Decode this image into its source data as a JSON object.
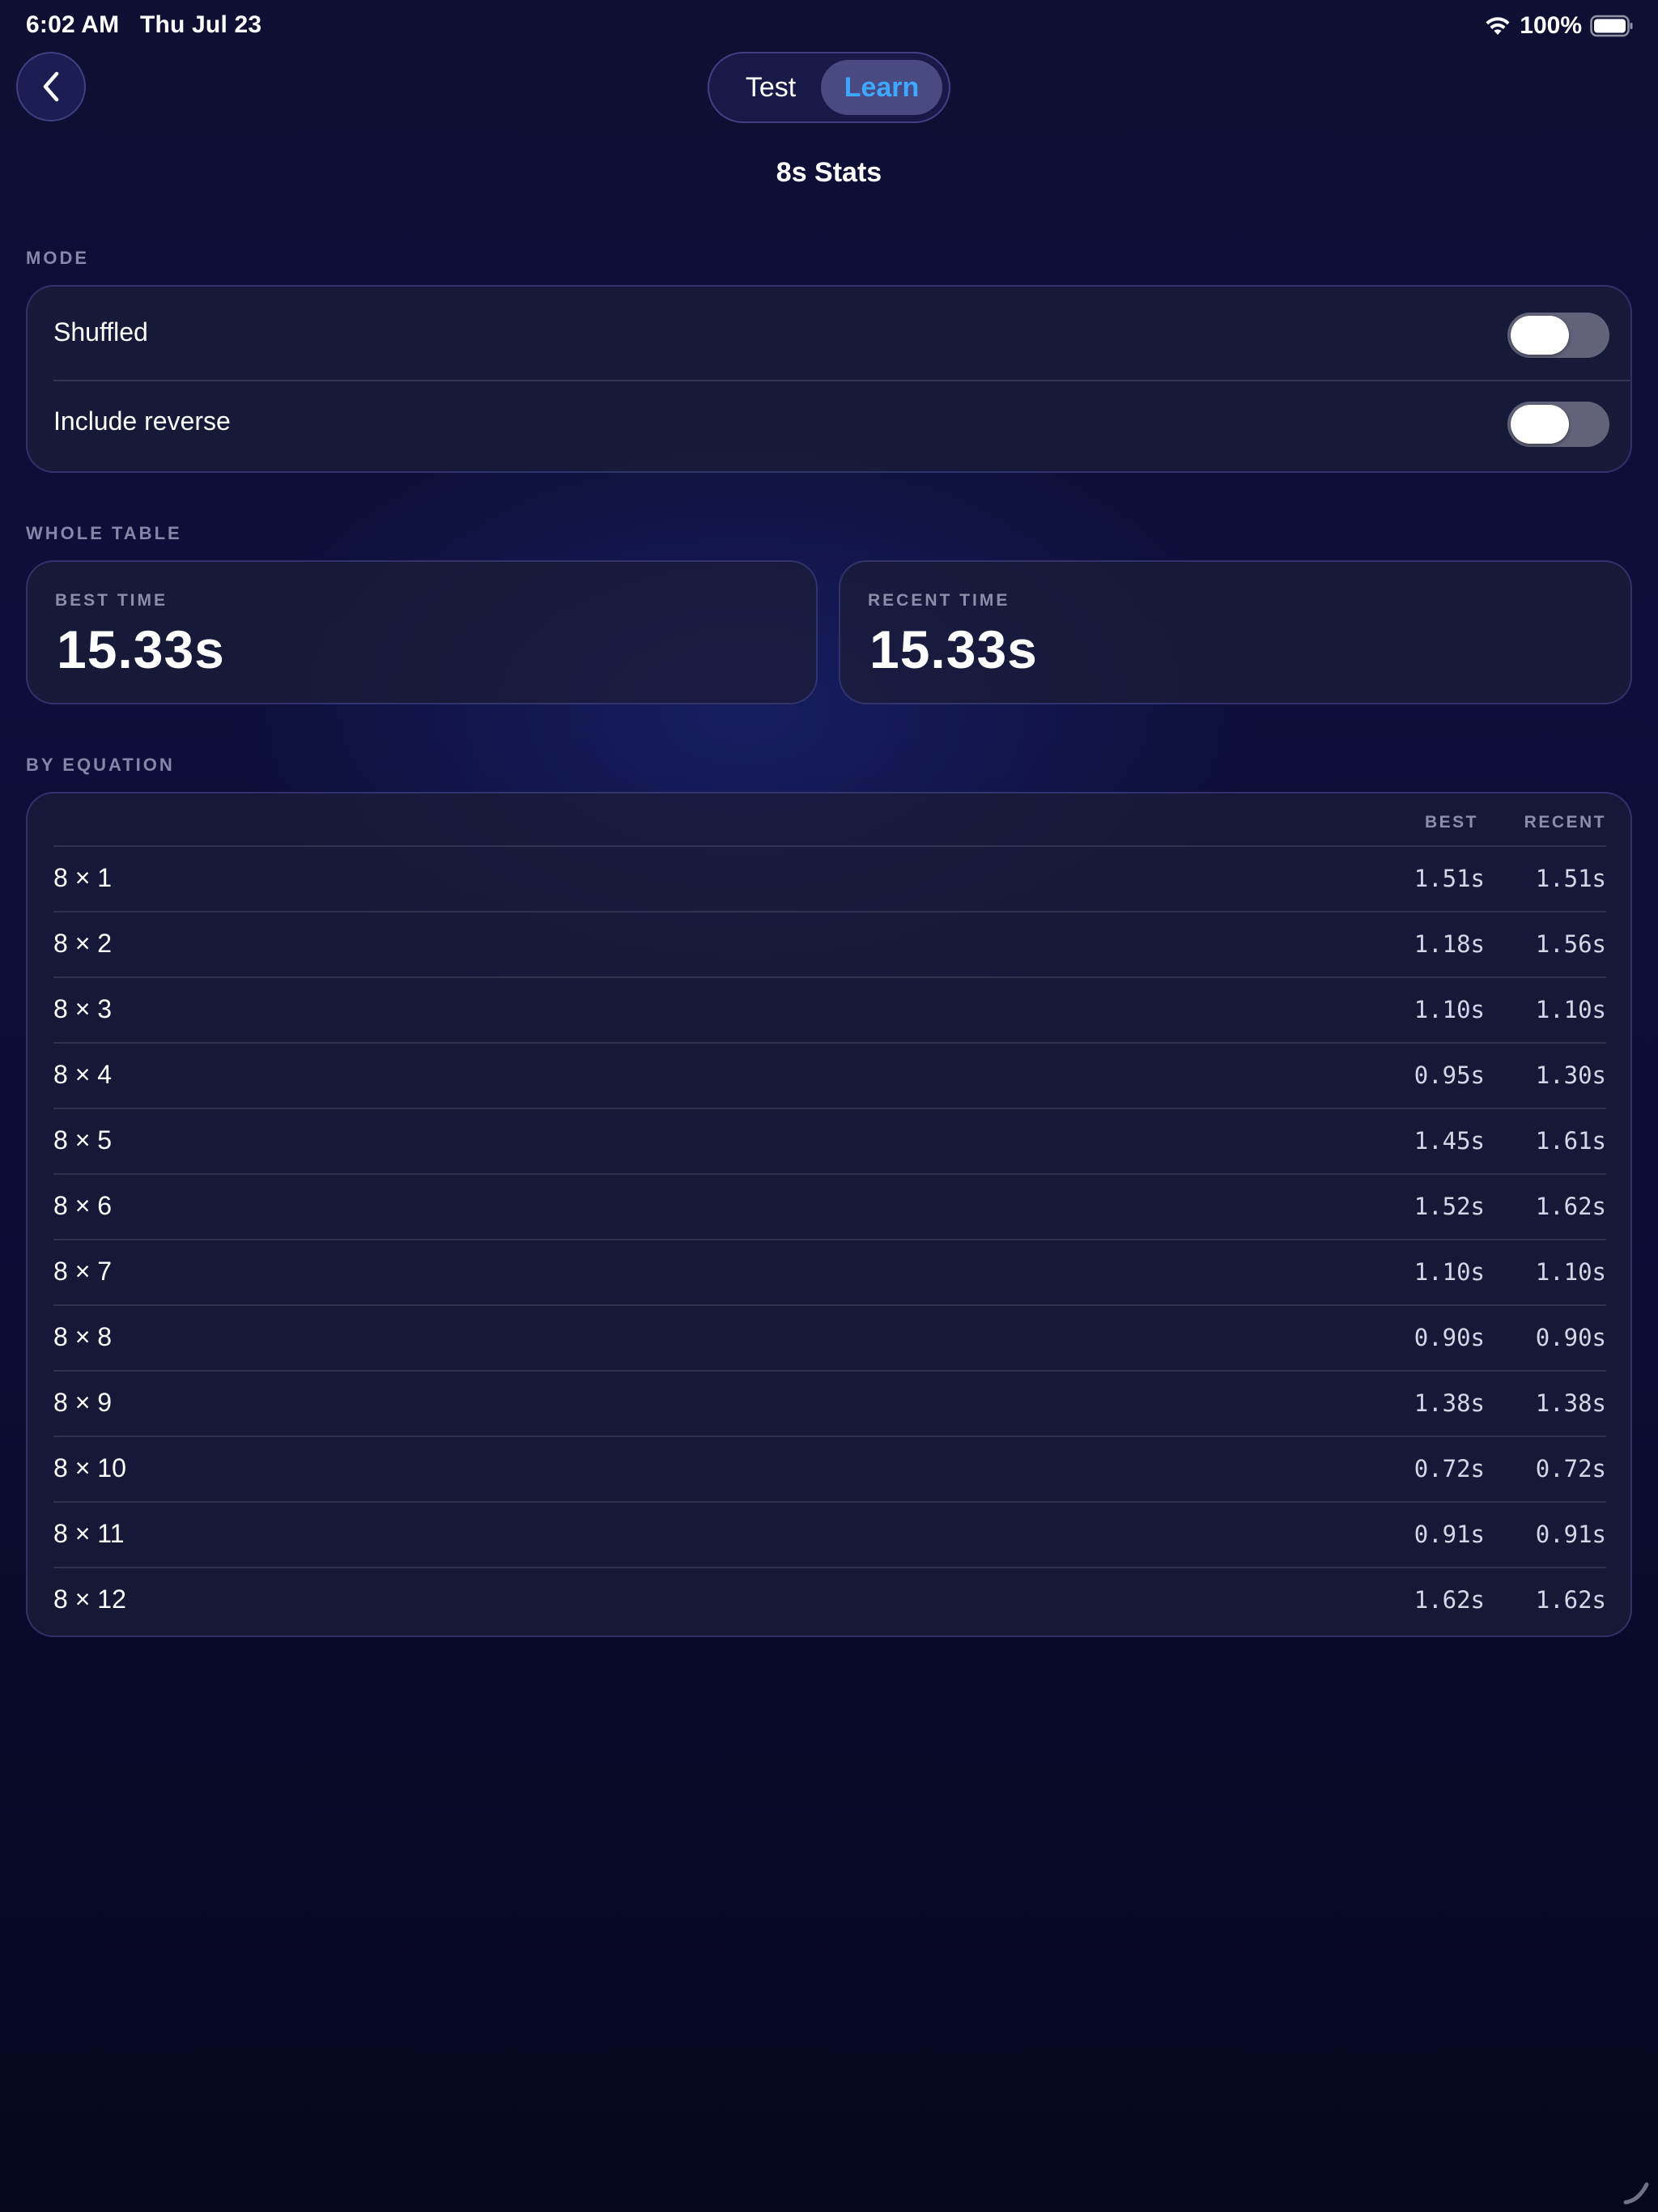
{
  "status_bar": {
    "time": "6:02 AM",
    "date": "Thu Jul 23",
    "battery": "100%"
  },
  "header": {
    "segments": [
      {
        "label": "Test",
        "selected": false
      },
      {
        "label": "Learn",
        "selected": true
      }
    ],
    "title": "8s Stats"
  },
  "mode": {
    "section_label": "MODE",
    "options": [
      {
        "label": "Shuffled",
        "on": false
      },
      {
        "label": "Include reverse",
        "on": false
      }
    ]
  },
  "whole_table": {
    "section_label": "WHOLE TABLE",
    "best_label": "BEST TIME",
    "best_value": "15.33s",
    "recent_label": "RECENT TIME",
    "recent_value": "15.33s"
  },
  "by_equation": {
    "section_label": "BY EQUATION",
    "col_best": "BEST",
    "col_recent": "RECENT",
    "rows": [
      {
        "equation": "8 × 1",
        "best": "1.51s",
        "recent": "1.51s"
      },
      {
        "equation": "8 × 2",
        "best": "1.18s",
        "recent": "1.56s"
      },
      {
        "equation": "8 × 3",
        "best": "1.10s",
        "recent": "1.10s"
      },
      {
        "equation": "8 × 4",
        "best": "0.95s",
        "recent": "1.30s"
      },
      {
        "equation": "8 × 5",
        "best": "1.45s",
        "recent": "1.61s"
      },
      {
        "equation": "8 × 6",
        "best": "1.52s",
        "recent": "1.62s"
      },
      {
        "equation": "8 × 7",
        "best": "1.10s",
        "recent": "1.10s"
      },
      {
        "equation": "8 × 8",
        "best": "0.90s",
        "recent": "0.90s"
      },
      {
        "equation": "8 × 9",
        "best": "1.38s",
        "recent": "1.38s"
      },
      {
        "equation": "8 × 10",
        "best": "0.72s",
        "recent": "0.72s"
      },
      {
        "equation": "8 × 11",
        "best": "0.91s",
        "recent": "0.91s"
      },
      {
        "equation": "8 × 12",
        "best": "1.62s",
        "recent": "1.62s"
      }
    ]
  },
  "colors": {
    "accent": "#3ea7ff",
    "background": "#0d0f3a"
  }
}
